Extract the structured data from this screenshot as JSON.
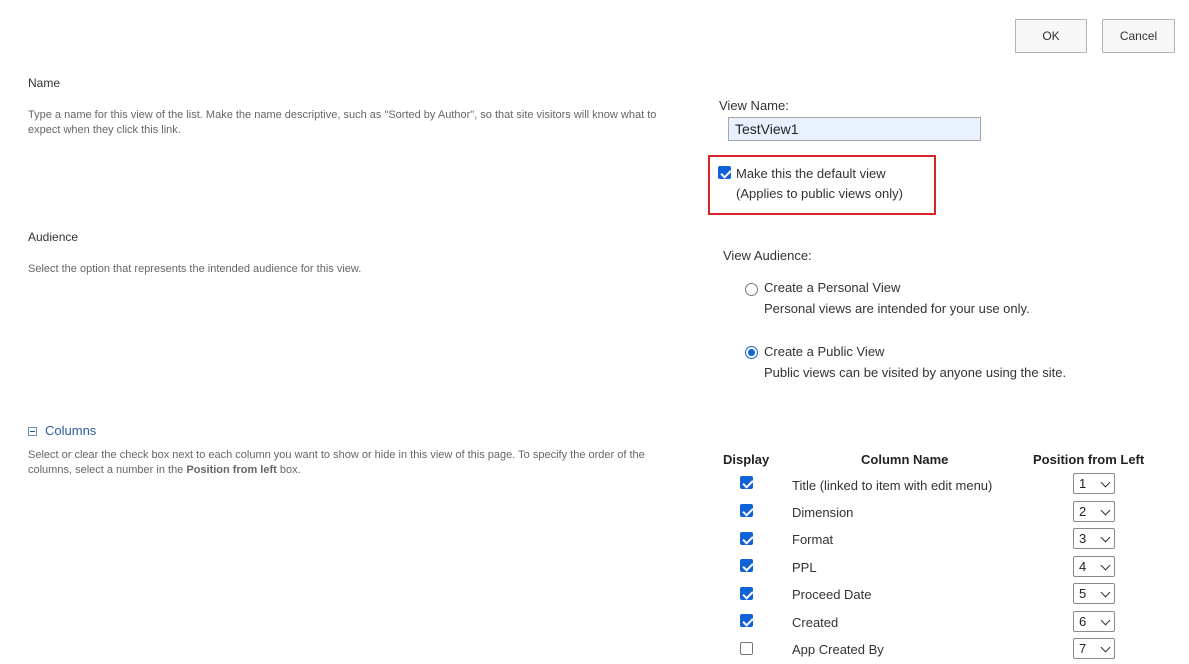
{
  "toolbar": {
    "ok_label": "OK",
    "cancel_label": "Cancel"
  },
  "name_section": {
    "title": "Name",
    "description_line1": "Type a name for this view of the list. Make the name descriptive, such as \"Sorted by Author\", so that site visitors will know what to",
    "description_line2": "expect when they click this link.",
    "view_name_label": "View Name:",
    "view_name_value": "TestView1",
    "default_view_label": "Make this the default view",
    "default_view_note": "(Applies to public views only)",
    "default_view_checked": true
  },
  "audience_section": {
    "title": "Audience",
    "description": "Select the option that represents the intended audience for this view.",
    "label": "View Audience:",
    "options": [
      {
        "label": "Create a Personal View",
        "note": "Personal views are intended for your use only.",
        "selected": false
      },
      {
        "label": "Create a Public View",
        "note": "Public views can be visited by anyone using the site.",
        "selected": true
      }
    ]
  },
  "columns_section": {
    "title": "Columns",
    "description_line1": "Select or clear the check box next to each column you want to show or hide in this view of this page. To specify the order of the",
    "description_line2_prefix": "columns, select a number in the ",
    "description_line2_bold": "Position from left",
    "description_line2_suffix": " box.",
    "headers": {
      "display": "Display",
      "column_name": "Column Name",
      "position": "Position from Left"
    },
    "rows": [
      {
        "checked": true,
        "name": "Title (linked to item with edit menu)",
        "position": "1"
      },
      {
        "checked": true,
        "name": "Dimension",
        "position": "2"
      },
      {
        "checked": true,
        "name": "Format",
        "position": "3"
      },
      {
        "checked": true,
        "name": "PPL",
        "position": "4"
      },
      {
        "checked": true,
        "name": "Proceed Date",
        "position": "5"
      },
      {
        "checked": true,
        "name": "Created",
        "position": "6"
      },
      {
        "checked": false,
        "name": "App Created By",
        "position": "7"
      }
    ]
  },
  "colors": {
    "accent": "#0f62d8",
    "highlight_border": "#d9242a",
    "link": "#2a5d9b"
  }
}
